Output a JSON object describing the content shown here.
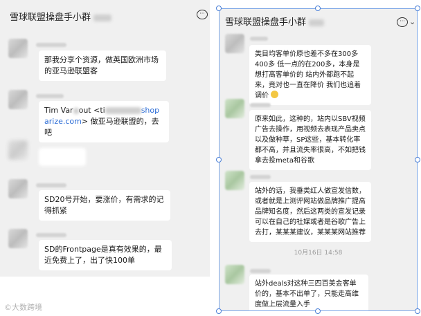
{
  "left_chat": {
    "title": "雪球联盟操盘手小群",
    "messages": [
      {
        "text": "那我分享个资源，做英国欧洲市场的亚马逊联盟客"
      },
      {
        "text_pre": "Tim Var",
        "text_mid": "out <ti",
        "text_link": "shop arize.com",
        "text_post": "> 做亚马逊联盟的，去吧"
      },
      {
        "text": ""
      },
      {
        "text": "SD20号开始，要涨价，有需求的记得抓紧"
      },
      {
        "text": "SD的Frontpage是真有效果的，最近免费上了，出了快100单"
      }
    ]
  },
  "right_chat": {
    "title": "雪球联盟操盘手小群",
    "messages": [
      {
        "text": "类目均客单价原也差不多在300多400多 低一点的在200多，本身是想打高客单价的 站内外都跑不起来，竟对也一直在降价 我们也追着调价"
      },
      {
        "text": "原来如此，这种的，站内以SBV视频广告去操作，用视频去表现产品卖点以及做种草，SP这些，基本转化率都不高，并且流失率很高，不如把钱拿去投meta和谷歌"
      },
      {
        "text": "站外的话，我垂类红人做宣发信数，或者就是上测评网站做品牌推广提高品牌知名度，然后这两类的宣发记录可以在自己的社媒或者是谷歌广告上去打，某某某建议，某某某网站推荐"
      },
      {
        "text": "站外deals对这种三四百美金客单价的，基本不出单了，只能走高维度做上层流量入手"
      }
    ],
    "timestamp": "10月16日 14:58"
  },
  "watermark": "大数跨境",
  "colors": {
    "panel_bg": "#f0f0f0",
    "bubble_bg": "#ffffff",
    "link": "#2b6cd6",
    "selection": "#7aa5e6"
  }
}
